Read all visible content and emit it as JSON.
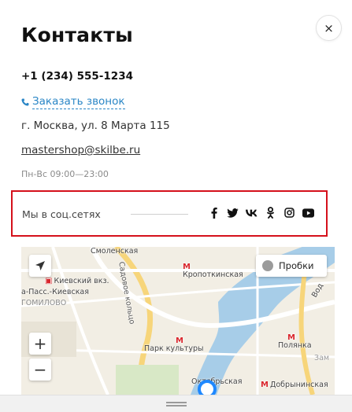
{
  "title": "Контакты",
  "close_label": "×",
  "phone": "+1 (234) 555-1234",
  "callback_label": "Заказать звонок",
  "address": "г. Москва, ул. 8 Марта 115",
  "email": "mastershop@skilbe.ru",
  "hours": "Пн-Вс 09:00—23:00",
  "social": {
    "label": "Мы в соц.сетях",
    "icons": [
      "facebook-icon",
      "twitter-icon",
      "vk-icon",
      "odnoklassniki-icon",
      "instagram-icon",
      "youtube-icon"
    ],
    "highlight_color": "#d5101b"
  },
  "map": {
    "traffic_label": "Пробки",
    "zoom_in": "+",
    "zoom_out": "−",
    "labels": {
      "smolenskaya": "Смоленская",
      "sadovoe": "Садовое кольцо",
      "kievsky": "Киевский вкз.",
      "pass_kievskaya": "а-Пасс.-Киевская",
      "dorogomilovo": "ГОМИЛОВО",
      "kropotkinskaya": "Кропоткинская",
      "park_kultury": "Парк культуры",
      "polyanka": "Полянка",
      "oktyabrskaya": "Октябрьская",
      "dobryninskaya": "Добрынинская",
      "vod": "Вод",
      "zam": "Зам"
    }
  },
  "colors": {
    "link": "#2a86c6",
    "metro": "#d9262c",
    "river": "#a7cde8"
  }
}
